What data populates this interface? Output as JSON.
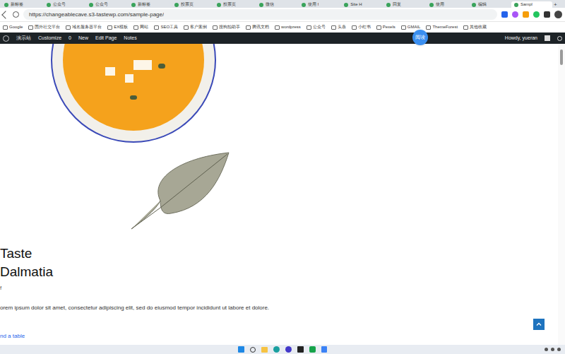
{
  "browser": {
    "tabs": [
      {
        "label": "新标签",
        "selected": false
      },
      {
        "label": "公众号",
        "selected": false
      },
      {
        "label": "公众号",
        "selected": false
      },
      {
        "label": "新标签",
        "selected": false
      },
      {
        "label": "投票页",
        "selected": false
      },
      {
        "label": "投票页",
        "selected": false
      },
      {
        "label": "微信",
        "selected": false
      },
      {
        "label": "使用 f",
        "selected": false
      },
      {
        "label": "Site H",
        "selected": false
      },
      {
        "label": "回复",
        "selected": false
      },
      {
        "label": "使用",
        "selected": false
      },
      {
        "label": "编辑",
        "selected": false
      },
      {
        "label": "Sampl",
        "selected": true
      }
    ],
    "url": "https://changeablecave.s3-tastewp.com/sample-page/",
    "bookmarks": [
      "Google",
      "国外社交平台",
      "域名服务器平台",
      "EX模板",
      "网站",
      "SEO工具",
      "客户案例",
      "搜狗拍助手",
      "腾讯文档",
      "wordpress",
      "公众号",
      "头条",
      "小红书",
      "Pexels",
      "GMAIL",
      "ThemeForest",
      "其他收藏"
    ]
  },
  "admin_bar": {
    "site": "演示站",
    "customize": "Customize",
    "comments": "0",
    "new": "New",
    "edit": "Edit Page",
    "notes": "Notes",
    "howdy": "Howdy, yueran"
  },
  "badge": "阅读",
  "page": {
    "title_lines": [
      "Taste",
      "Dalmatia"
    ],
    "meta": "f",
    "excerpt": "orem ipsum dolor sit amet, consectetur adipiscing elit, sed do eiusmod tempor incididunt ut labore et dolore.",
    "link": "nd a table"
  }
}
